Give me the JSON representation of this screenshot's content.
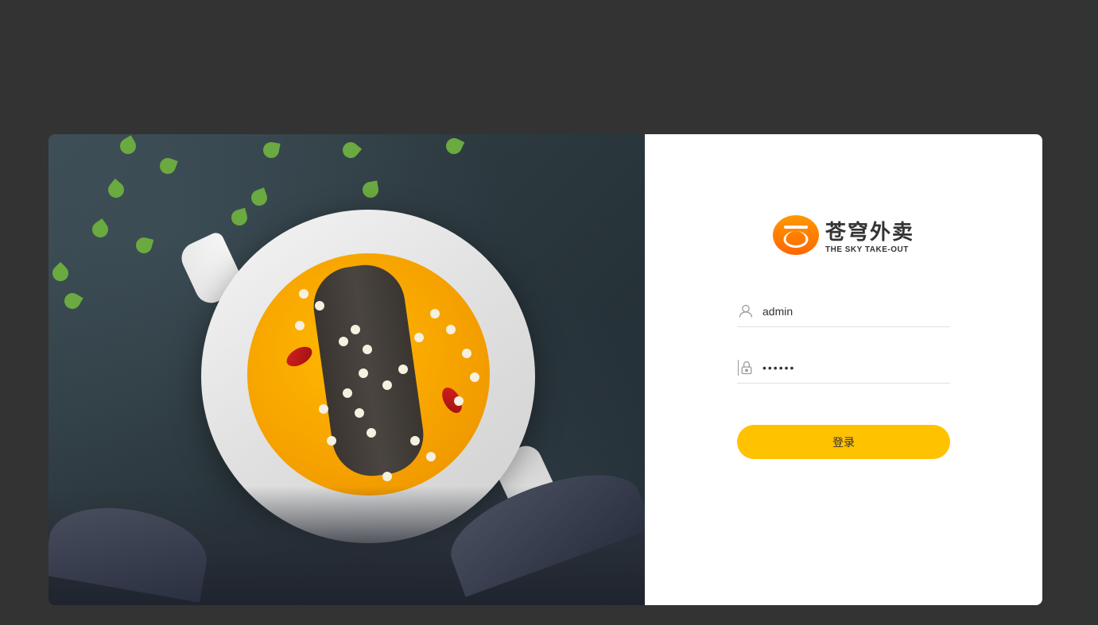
{
  "logo": {
    "chinese_name": "苍穹外卖",
    "english_name": "THE SKY TAKE-OUT"
  },
  "form": {
    "username_value": "admin",
    "password_value": "••••••",
    "login_button_label": "登录"
  },
  "colors": {
    "background": "#333333",
    "login_button": "#ffc200",
    "logo_primary": "#ff9900"
  }
}
